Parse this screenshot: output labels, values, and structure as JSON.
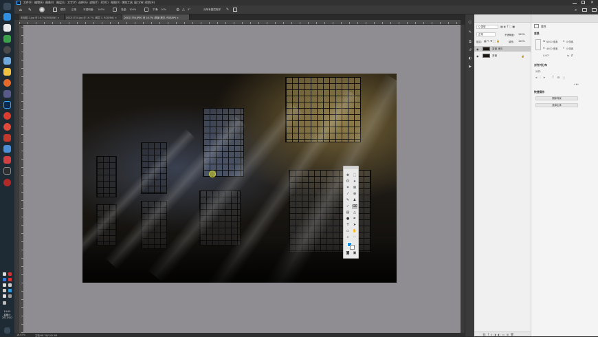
{
  "menubar": {
    "items": [
      "文件(F)",
      "编辑(E)",
      "图像(I)",
      "图层(L)",
      "文字(Y)",
      "选择(S)",
      "滤镜(T)",
      "3D(D)",
      "视图(V)",
      "增效工具",
      "窗口(W)",
      "帮助(H)"
    ]
  },
  "options": {
    "mode_label": "模式:",
    "mode_value": "正常",
    "opacity_label": "不透明度:",
    "opacity_value": "100%",
    "flow_label": "流量:",
    "flow_value": "100%",
    "smooth_label": "平滑:",
    "smooth_value": "10%",
    "angle_value": "0°",
    "sample_all_label": "对所有图层取样"
  },
  "tabs": [
    {
      "label": "未标题-1.jpg @ 16.7%(RGB/8#) ×",
      "active": false
    },
    {
      "label": "DSC01754.jpg @ 16.7% (图层 1, RGB/8#) ×",
      "active": false
    },
    {
      "label": "DSC01754.JPEG @ 16.7% (背景 拷贝, RGB/8*) ×",
      "active": true
    }
  ],
  "status": {
    "zoom": "16.67%",
    "doc_size": "文档:68.7M/142.5M"
  },
  "layers_panel": {
    "search_placeholder": "Q 类型",
    "blend_mode": "正常",
    "opacity_label": "不透明度:",
    "opacity_value": "100%",
    "lock_label": "锁定:",
    "fill_label": "填充:",
    "fill_value": "100%",
    "layers": [
      {
        "name": "背景 拷贝",
        "selected": true
      },
      {
        "name": "背景",
        "selected": false,
        "locked": true
      }
    ]
  },
  "properties_panel": {
    "tab_label": "属性",
    "section_transform": "变换",
    "w_label": "W",
    "w_value": "6000 像素",
    "h_label": "H",
    "h_value": "4000 像素",
    "x_label": "X",
    "x_value": "0 像素",
    "y_label": "Y",
    "y_value": "0 像素",
    "angle_value": "0.00°",
    "section_align": "对齐并分布",
    "align_label": "对齐:",
    "section_quick": "快速操作",
    "btn_remove_bg": "删除背景",
    "btn_select_subject": "选择主体"
  },
  "taskbar": {
    "time": "14:05",
    "weekday": "星期六",
    "date": "2023/1/2"
  }
}
